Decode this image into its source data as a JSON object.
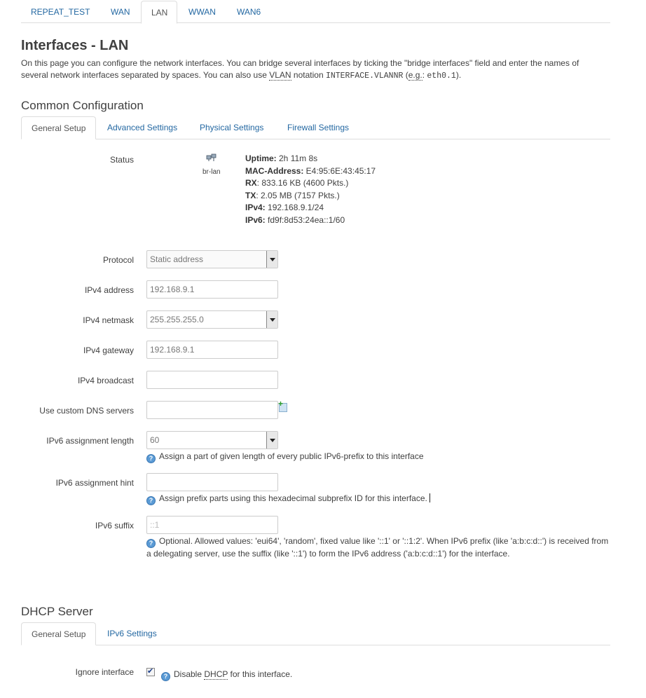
{
  "top_tabs": [
    "REPEAT_TEST",
    "WAN",
    "LAN",
    "WWAN",
    "WAN6"
  ],
  "page": {
    "title": "Interfaces - LAN",
    "desc_part1": "On this page you can configure the network interfaces. You can bridge several interfaces by ticking the \"bridge interfaces\" field and enter the names of several network interfaces separated by spaces. You can also use ",
    "desc_vlan": "VLAN",
    "desc_part2": " notation ",
    "desc_code1": "INTERFACE.VLANNR",
    "desc_part3": " (",
    "desc_eg": "e.g.",
    "desc_part4": ": ",
    "desc_code2": "eth0.1",
    "desc_part5": ")."
  },
  "common": {
    "title": "Common Configuration",
    "tabs": [
      "General Setup",
      "Advanced Settings",
      "Physical Settings",
      "Firewall Settings"
    ]
  },
  "status": {
    "label": "Status",
    "iface": "br-lan",
    "uptime_label": "Uptime:",
    "uptime": " 2h 11m 8s",
    "mac_label": "MAC-Address:",
    "mac": " E4:95:6E:43:45:17",
    "rx_label": "RX",
    "rx": ": 833.16 KB (4600 Pkts.)",
    "tx_label": "TX",
    "tx": ": 2.05 MB (7157 Pkts.)",
    "ipv4_label": "IPv4:",
    "ipv4": " 192.168.9.1/24",
    "ipv6_label": "IPv6:",
    "ipv6": " fd9f:8d53:24ea::1/60"
  },
  "fields": {
    "protocol": {
      "label": "Protocol",
      "value": "Static address"
    },
    "ipv4_address": {
      "label": "IPv4 address",
      "value": "192.168.9.1"
    },
    "ipv4_netmask": {
      "label": "IPv4 netmask",
      "value": "255.255.255.0"
    },
    "ipv4_gateway": {
      "label": "IPv4 gateway",
      "value": "192.168.9.1"
    },
    "ipv4_broadcast": {
      "label": "IPv4 broadcast",
      "value": ""
    },
    "dns": {
      "label": "Use custom DNS servers",
      "value": ""
    },
    "ipv6_len": {
      "label": "IPv6 assignment length",
      "value": "60",
      "hint": "Assign a part of given length of every public IPv6-prefix to this interface"
    },
    "ipv6_hint": {
      "label": "IPv6 assignment hint",
      "value": "",
      "hint": "Assign prefix parts using this hexadecimal subprefix ID for this interface."
    },
    "ipv6_suffix": {
      "label": "IPv6 suffix",
      "placeholder": "::1",
      "hint_line1": "Optional. Allowed values: 'eui64', 'random', fixed value like '::1' or '::1:2'. When IPv6 prefix (like 'a:b:c:d::') is received from",
      "hint_line2": "a delegating server, use the suffix (like '::1') to form the IPv6 address ('a:b:c:d::1') for the interface."
    }
  },
  "dhcp": {
    "title": "DHCP Server",
    "tabs": [
      "General Setup",
      "IPv6 Settings"
    ],
    "ignore_label": "Ignore interface",
    "ignore_checked": true,
    "ignore_hint_pre": "Disable ",
    "ignore_hint_abbr": "DHCP",
    "ignore_hint_post": " for this interface."
  },
  "colors": {
    "link": "#2468a2",
    "text": "#404040",
    "border": "#dddddd"
  }
}
